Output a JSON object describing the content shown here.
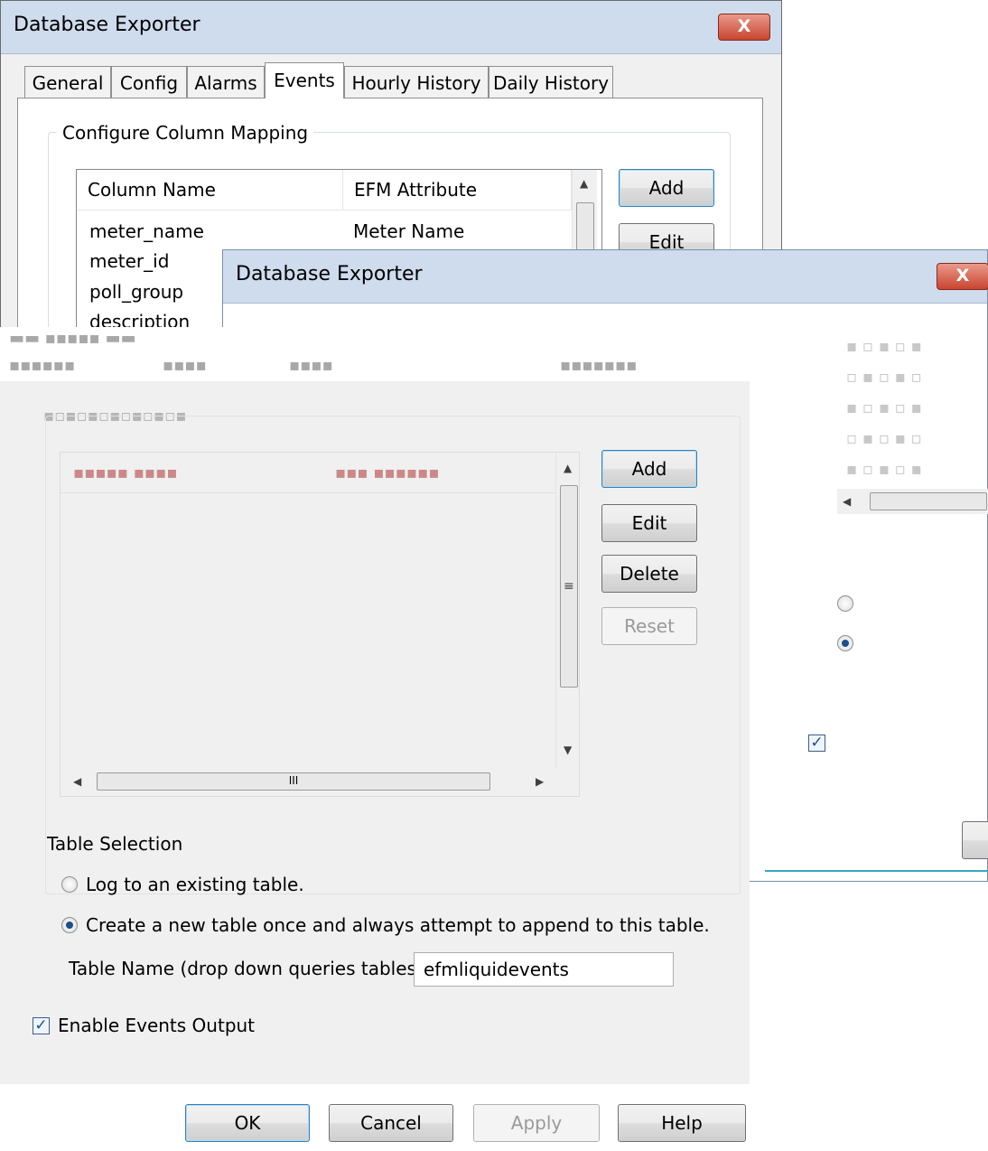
{
  "back_window": {
    "title": "Database Exporter",
    "close_label": "X",
    "tabs": [
      "General",
      "Config",
      "Alarms",
      "Events",
      "Hourly History",
      "Daily History"
    ],
    "active_tab": "Events",
    "group_label": "Configure Column Mapping",
    "columns": [
      "Column Name",
      "EFM Attribute"
    ],
    "rows": [
      [
        "meter_name",
        "Meter Name"
      ],
      [
        "meter_id",
        ""
      ],
      [
        "poll_group",
        ""
      ],
      [
        "description",
        ""
      ]
    ],
    "buttons": {
      "add": "Add",
      "edit": "Edit"
    }
  },
  "middle_window": {
    "title": "Database Exporter",
    "close_label": "X"
  },
  "front_window": {
    "buttons": {
      "add": "Add",
      "edit": "Edit",
      "delete": "Delete",
      "reset": "Reset"
    },
    "hscroll_grip": "III",
    "table_selection": {
      "label": "Table Selection",
      "option_existing": "Log to an existing table.",
      "option_new": "Create a new table once and always attempt to append to this table.",
      "selected": "new",
      "table_name_label": "Table Name (drop down queries tables)",
      "table_name_value": "efmliquidevents"
    },
    "enable_output": {
      "label": "Enable Events Output",
      "checked": true
    },
    "footer": {
      "ok": "OK",
      "cancel": "Cancel",
      "apply": "Apply",
      "help": "Help"
    }
  }
}
